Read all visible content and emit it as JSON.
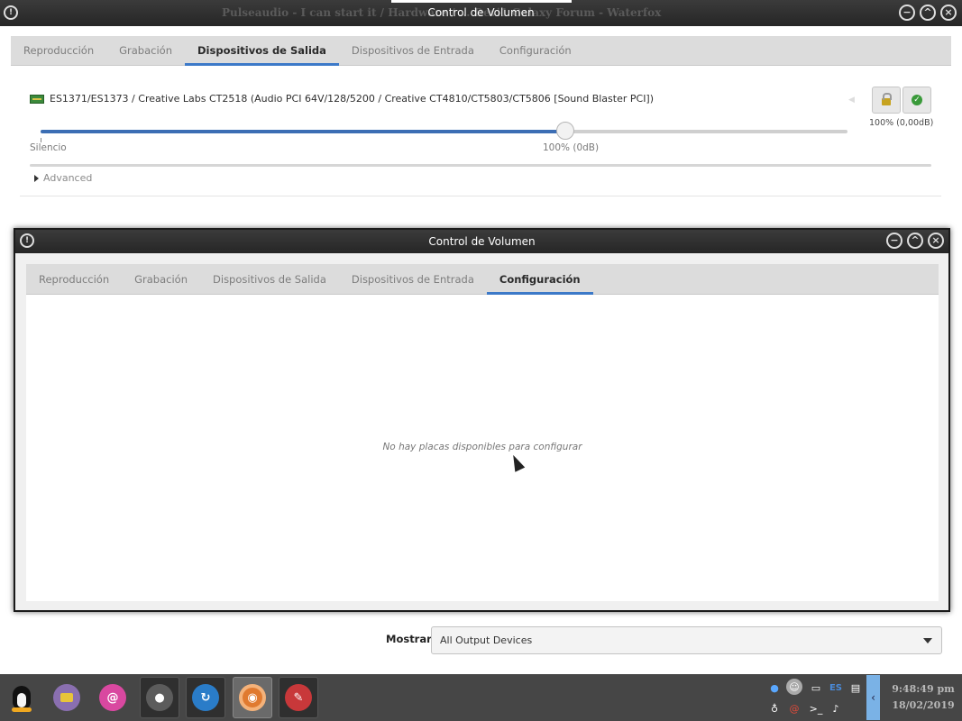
{
  "back_window": {
    "title": "Control de Volumen",
    "ghost_title": "Pulseaudio - I can start it / Hardware / ... Devi1 Galaxy Forum - Waterfox",
    "tabs": [
      "Reproducción",
      "Grabación",
      "Dispositivos de Salida",
      "Dispositivos de Entrada",
      "Configuración"
    ],
    "active_tab": 2,
    "device": {
      "name": "ES1371/ES1373 / Creative Labs CT2518 (Audio PCI 64V/128/5200 / Creative CT4810/CT5803/CT5806 [Sound Blaster PCI])",
      "volume_fraction": 0.65,
      "label_min": "Silencio",
      "label_100": "100% (0dB)",
      "db_label": "100% (0,00dB)",
      "advanced_label": "Advanced"
    },
    "footer": {
      "show_label": "Mostrar:",
      "select_value": "All Output Devices"
    }
  },
  "front_window": {
    "title": "Control de Volumen",
    "tabs": [
      "Reproducción",
      "Grabación",
      "Dispositivos de Salida",
      "Dispositivos de Entrada",
      "Configuración"
    ],
    "active_tab": 4,
    "empty_message": "No hay placas disponibles para configurar"
  },
  "taskbar": {
    "apps": [
      {
        "name": "tux-icon",
        "color": "#111111"
      },
      {
        "name": "money-icon",
        "color": "#8a6fb0"
      },
      {
        "name": "anki-icon",
        "color": "#d948a0"
      },
      {
        "name": "drop-icon",
        "color": "#6a6a6a"
      },
      {
        "name": "refresh-icon",
        "color": "#2a7cc8"
      },
      {
        "name": "speaker-app-icon",
        "color": "#e07a30"
      },
      {
        "name": "pen-icon",
        "color": "#c8383a"
      }
    ],
    "tray": {
      "lang": "ES",
      "clock_time": "9:48:49 pm",
      "clock_date": "18/02/2019"
    }
  }
}
